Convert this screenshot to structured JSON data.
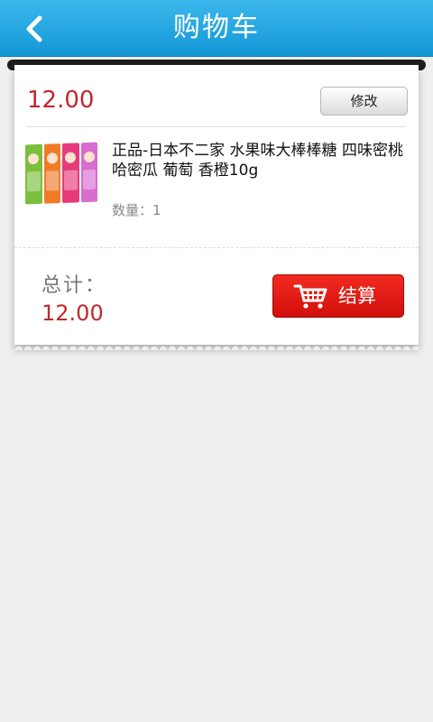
{
  "header": {
    "title": "购物车",
    "back_icon": "chevron-left-icon",
    "background_color": "#1a9fe0"
  },
  "cart": {
    "item": {
      "price": "12.00",
      "edit_label": "修改",
      "name": "正品-日本不二家 水果味大棒棒糖 四味密桃 哈密瓜 葡萄 香橙10g",
      "quantity": "数量：1",
      "thumbnail": "product-thumbnail"
    },
    "summary": {
      "total_label": "总计：",
      "total_value": "12.00"
    },
    "checkout": {
      "label": "结算",
      "icon": "shopping-cart-icon",
      "color": "#e01a14"
    }
  },
  "colors": {
    "price": "#c1272d",
    "page_background": "#efefef"
  }
}
